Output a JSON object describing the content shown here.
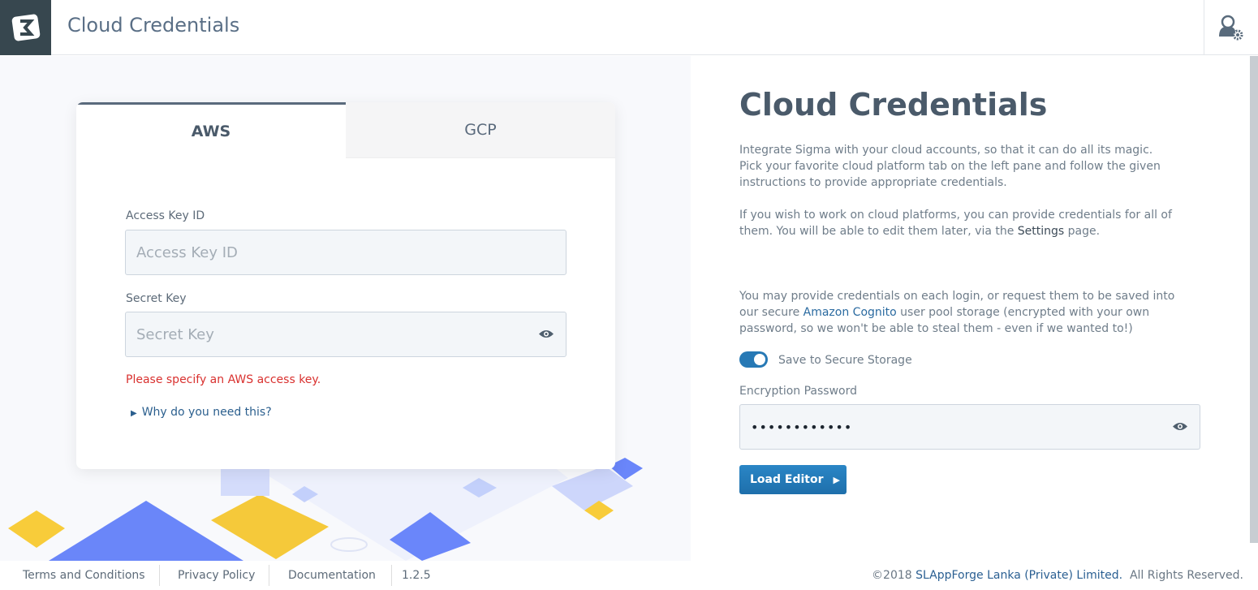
{
  "header": {
    "title": "Cloud Credentials",
    "logo_icon": "sigma-logo",
    "user_icon": "user-settings-icon"
  },
  "card": {
    "tabs": [
      {
        "label": "AWS",
        "active": true
      },
      {
        "label": "GCP",
        "active": false
      }
    ],
    "access_key": {
      "label": "Access Key ID",
      "placeholder": "Access Key ID",
      "value": ""
    },
    "secret_key": {
      "label": "Secret Key",
      "placeholder": "Secret Key",
      "value": ""
    },
    "error": "Please specify an AWS access key.",
    "why_link": "Why do you need this?"
  },
  "info": {
    "title": "Cloud Credentials",
    "para1": "Integrate Sigma with your cloud accounts, so that it can do all its magic. Pick your favorite cloud platform tab on the left pane and follow the given instructions to provide appropriate credentials.",
    "para2_pre": "If you wish to work on cloud platforms, you can provide credentials for all of them. You will be able to edit them later, via the ",
    "para2_link": "Settings",
    "para2_post": " page.",
    "para3_pre": "You may provide credentials on each login, or request them to be saved into our secure ",
    "para3_link": "Amazon Cognito",
    "para3_post": " user pool storage (encrypted with your own password, so we won't be able to steal them - even if we wanted to!)",
    "toggle_label": "Save to Secure Storage",
    "toggle_on": true,
    "password_label": "Encryption Password",
    "password_value": "••••••••••••",
    "load_button": "Load Editor"
  },
  "footer": {
    "links": [
      "Terms and Conditions",
      "Privacy Policy",
      "Documentation"
    ],
    "version": "1.2.5",
    "copyright_pre": "©2018 ",
    "company": "SLAppForge Lanka (Private) Limited.",
    "copyright_post": "  All Rights Reserved."
  },
  "colors": {
    "accent": "#2779b5",
    "error": "#d9312f",
    "logo_bg": "#37474f"
  }
}
